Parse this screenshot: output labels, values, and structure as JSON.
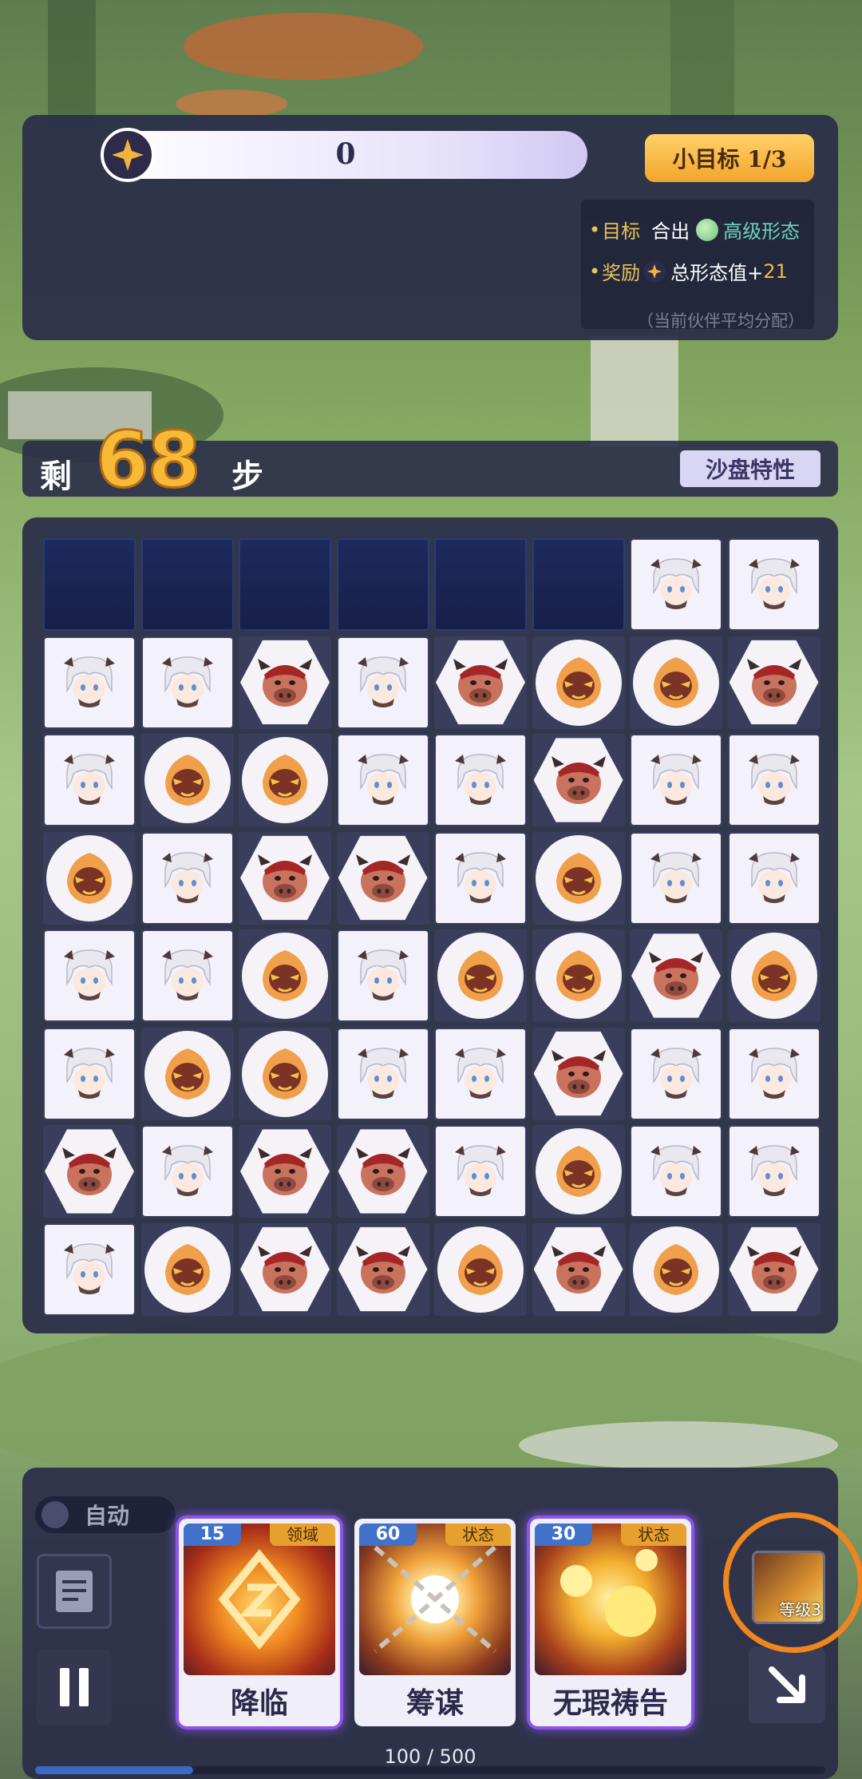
{
  "top": {
    "score": "0",
    "goal_badge": "小目标 1/3",
    "target_label": "目标",
    "target_text": "合出",
    "target_form": "高级形态",
    "reward_label": "奖励",
    "reward_text": "总形态值+",
    "reward_amount": "21",
    "distribute_note": "（当前伙伴平均分配）"
  },
  "steps": {
    "prefix": "剩",
    "count": "68",
    "suffix": "步",
    "sandbox_button": "沙盘特性"
  },
  "board": {
    "rows": 8,
    "cols": 8,
    "tile_kinds": {
      "G": "white-haired-girl",
      "B": "red-bull",
      "O": "orange-spirit",
      "_": "empty"
    },
    "grid": [
      "______GG",
      "GGBGBOOB",
      "GOOGGBGG",
      "OGBBGOGG",
      "GGOGOOBO",
      "GOOGGBGG",
      "BGBBGOGG",
      "GOBBOBOB"
    ]
  },
  "bottom": {
    "auto_label": "自动",
    "cards": [
      {
        "cost": "15",
        "tag": "领域",
        "name": "降临",
        "art_icon": "gold-rune-icon"
      },
      {
        "cost": "60",
        "tag": "状态",
        "name": "筹谋",
        "art_icon": "chain-burst-icon"
      },
      {
        "cost": "30",
        "tag": "状态",
        "name": "无瑕祷告",
        "art_icon": "light-orbs-icon"
      }
    ],
    "level_label": "等级3",
    "energy_text": "100 / 500",
    "energy_fraction": 0.2
  },
  "colors": {
    "panel": "#2a2d48",
    "accent_gold": "#f7b937",
    "energy_blue": "#3b6ac0",
    "annotation_orange": "#f2851e"
  }
}
